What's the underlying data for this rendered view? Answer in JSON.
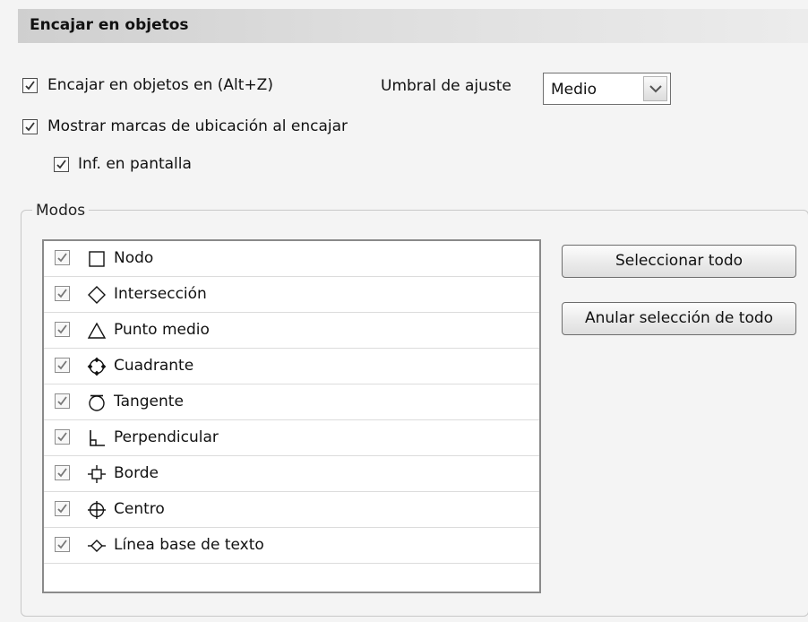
{
  "header": {
    "title": "Encajar en objetos"
  },
  "options": {
    "snap_enabled": {
      "label": "Encajar en objetos en (Alt+Z)",
      "checked": true
    },
    "show_markers": {
      "label": "Mostrar marcas de ubicación al encajar",
      "checked": true
    },
    "on_screen_info": {
      "label": "Inf. en pantalla",
      "checked": true
    }
  },
  "threshold": {
    "label": "Umbral de ajuste",
    "value": "Medio"
  },
  "modes": {
    "legend": "Modos",
    "items": [
      {
        "label": "Nodo",
        "icon": "square-node-icon",
        "checked": true
      },
      {
        "label": "Intersección",
        "icon": "diamond-intersection-icon",
        "checked": true
      },
      {
        "label": "Punto medio",
        "icon": "triangle-midpoint-icon",
        "checked": true
      },
      {
        "label": "Cuadrante",
        "icon": "circle-quadrant-icon",
        "checked": true
      },
      {
        "label": "Tangente",
        "icon": "circle-tangent-icon",
        "checked": true
      },
      {
        "label": "Perpendicular",
        "icon": "perpendicular-icon",
        "checked": true
      },
      {
        "label": "Borde",
        "icon": "square-edge-icon",
        "checked": true
      },
      {
        "label": "Centro",
        "icon": "circle-center-icon",
        "checked": true
      },
      {
        "label": "Línea base de texto",
        "icon": "diamond-baseline-icon",
        "checked": true
      }
    ]
  },
  "buttons": {
    "select_all": "Seleccionar todo",
    "deselect_all": "Anular selección de todo"
  },
  "colors": {
    "header_bg": "#d6d6d6",
    "panel_bg": "#f4f4f4",
    "list_bg": "#ffffff"
  }
}
